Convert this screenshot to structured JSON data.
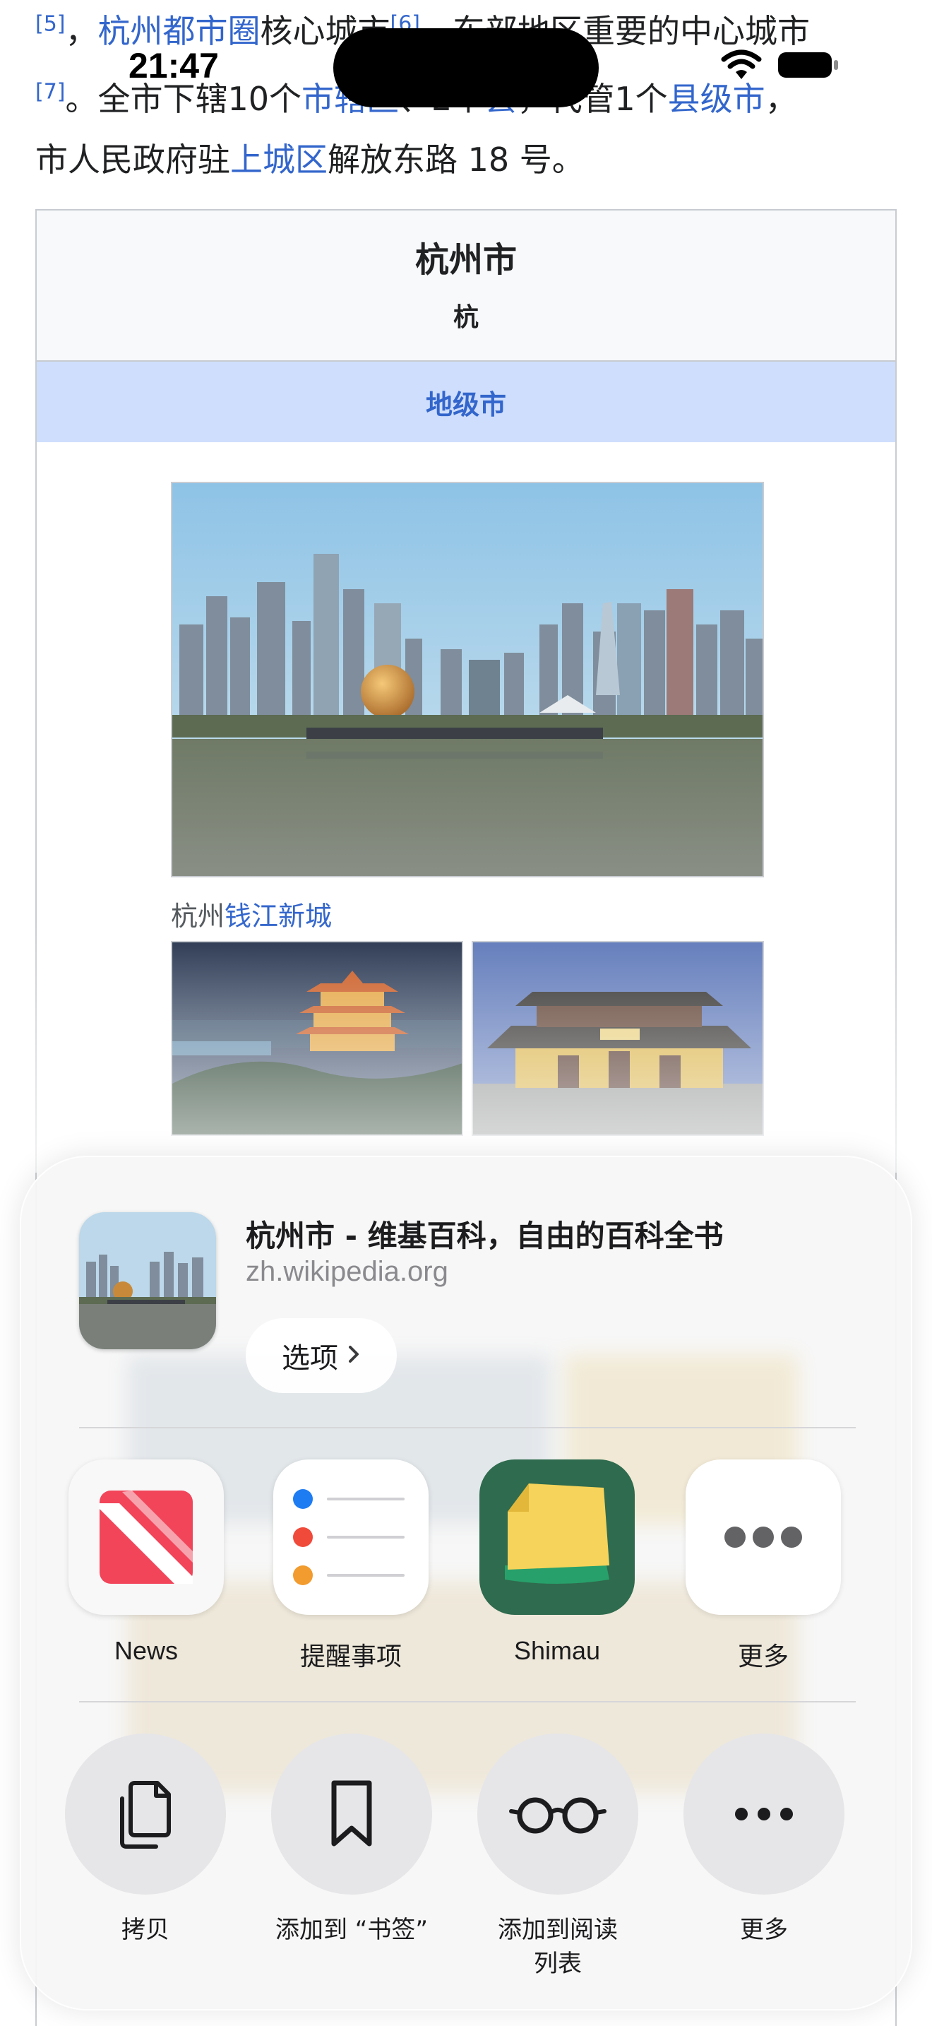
{
  "status_bar": {
    "time": "21:47"
  },
  "article": {
    "line1": {
      "ref1": "[5]",
      "sep": "，",
      "link1": "杭州都市圈",
      "text1": "核心城市",
      "ref2": "[6]",
      "text2": "，东部地区重要的中心城市"
    },
    "line2": {
      "ref": "[7]",
      "text1": "。全市下辖10个",
      "link1": "市辖区",
      "text2": "、2个",
      "link2": "县",
      "text3": "，代管1个",
      "link3": "县级市",
      "text4": "，"
    },
    "line3": {
      "text1": "市人民政府驻",
      "link1": "上城区",
      "text2": "解放东路 18 号。"
    }
  },
  "infobox": {
    "title": "杭州市",
    "subtitle": "杭",
    "band": "地级市",
    "caption_prefix": "杭州",
    "caption_link": "钱江新城"
  },
  "share_sheet": {
    "page_title": "杭州市 - 维基百科，自由的百科全书",
    "page_url": "zh.wikipedia.org",
    "options_label": "选项",
    "apps": [
      {
        "label": "News",
        "icon": "news-icon"
      },
      {
        "label": "提醒事项",
        "icon": "reminders-icon"
      },
      {
        "label": "Shimau",
        "icon": "shimau-icon"
      },
      {
        "label": "更多",
        "icon": "more-dots-icon"
      }
    ],
    "actions": [
      {
        "label": "拷贝",
        "icon": "copy-icon"
      },
      {
        "label": "添加到 “书签”",
        "icon": "bookmark-icon"
      },
      {
        "label_line1": "添加到阅读",
        "label_line2": "列表",
        "icon": "reading-glasses-icon"
      },
      {
        "label": "更多",
        "icon": "more-dots-icon"
      }
    ]
  },
  "colors": {
    "link": "#3366cc",
    "band": "#cfdefc",
    "news_red": "#f2455a",
    "shimau_green": "#2f6b4e"
  }
}
